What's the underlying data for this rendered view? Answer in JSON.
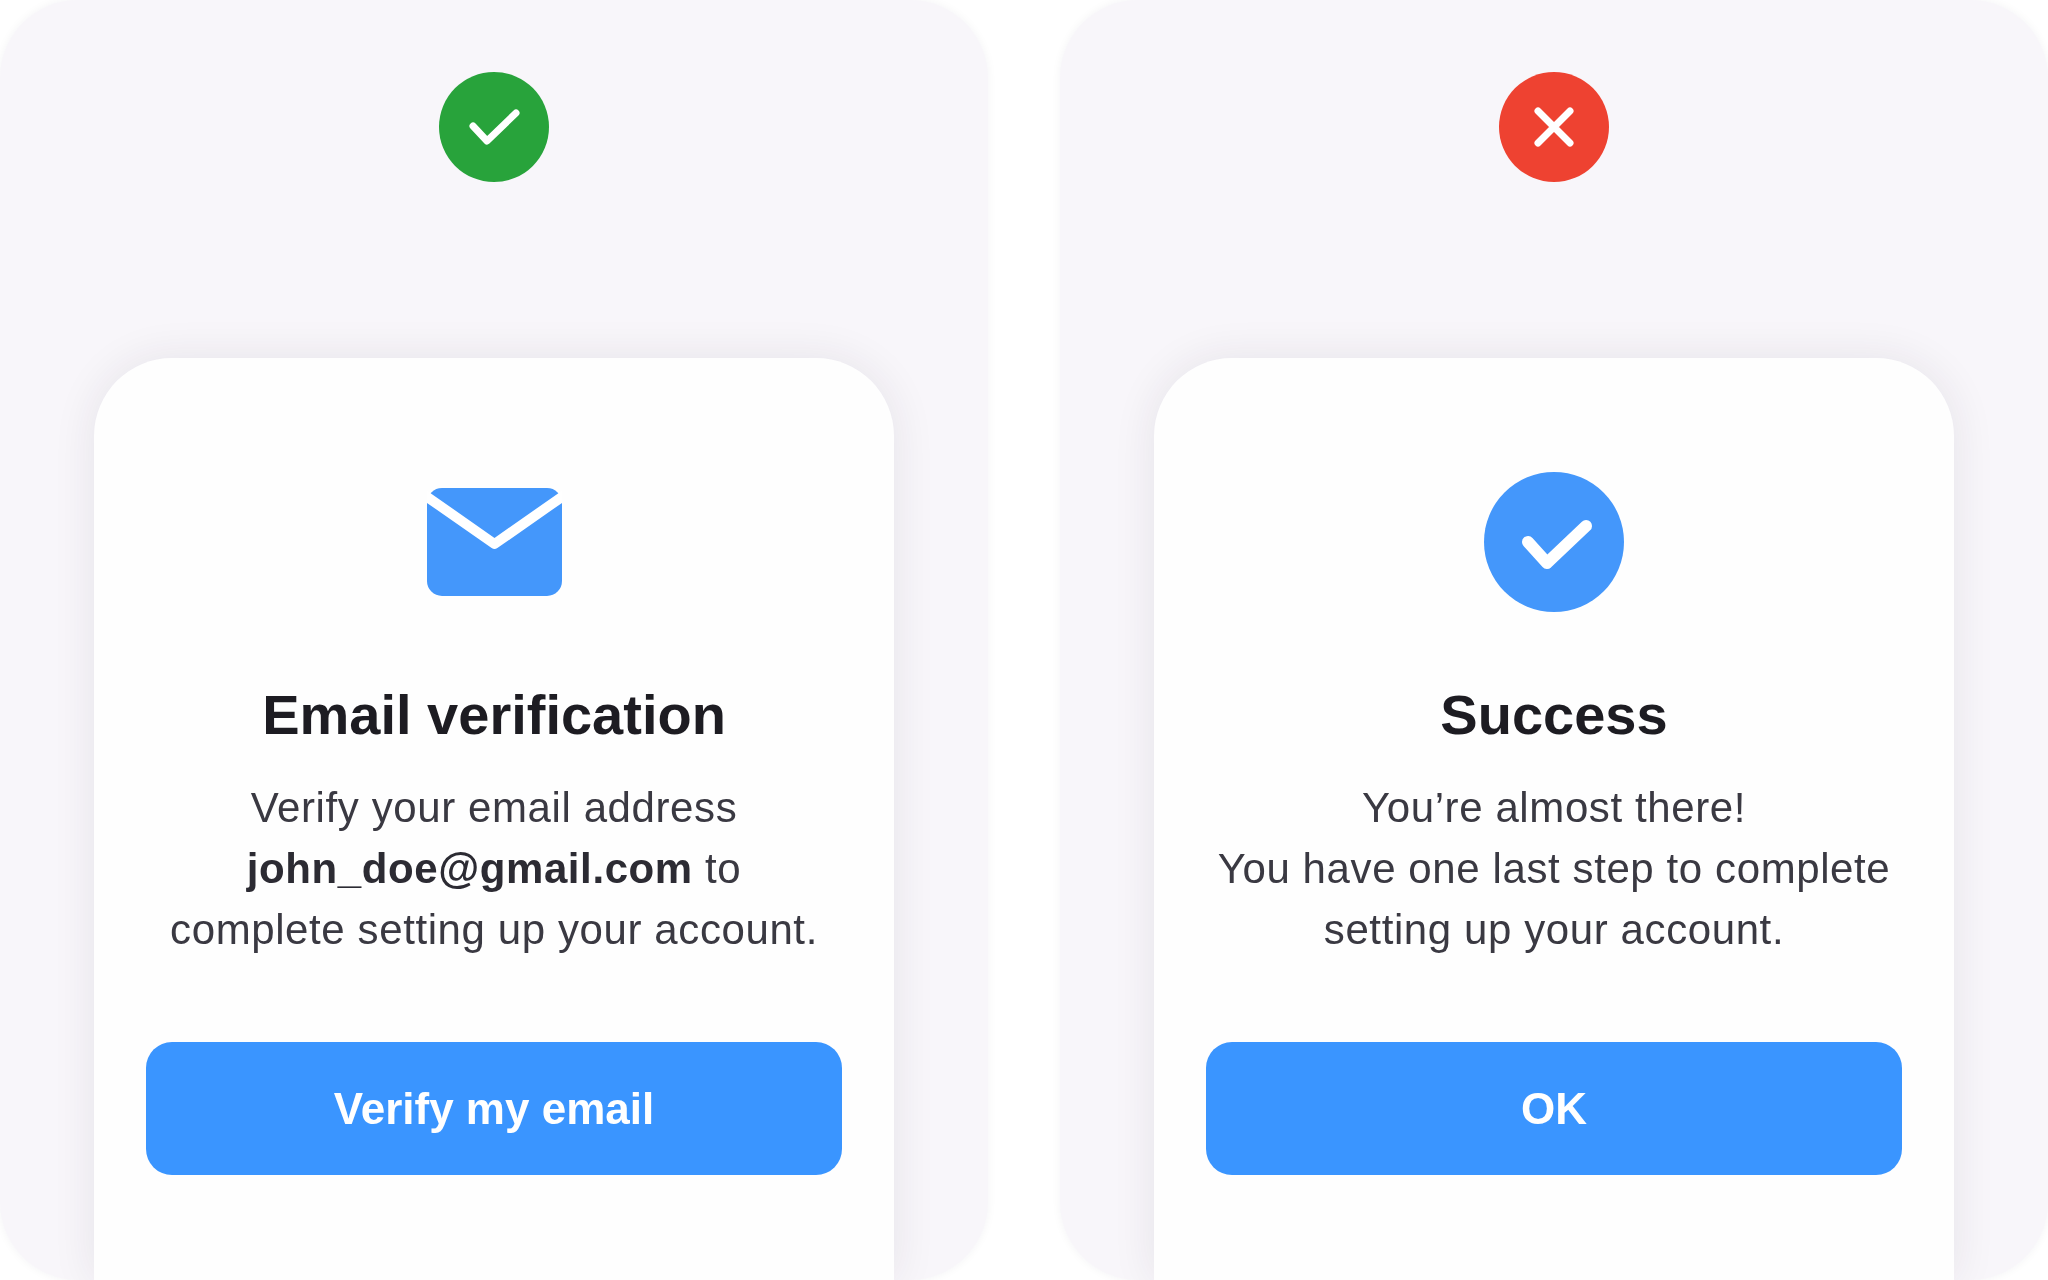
{
  "panels": [
    {
      "approved": true,
      "card": {
        "kind": "verification",
        "title": "Email verification",
        "message": "Verify your email address\n**john_doe@gmail.com** to\ncomplete setting up your account.",
        "button": "Verify my email"
      }
    },
    {
      "approved": false,
      "card": {
        "kind": "confirmation",
        "title": "Success",
        "message": "You’re almost there!\nYou have one last step to complete\nsetting up your account.",
        "button": "OK"
      }
    }
  ]
}
